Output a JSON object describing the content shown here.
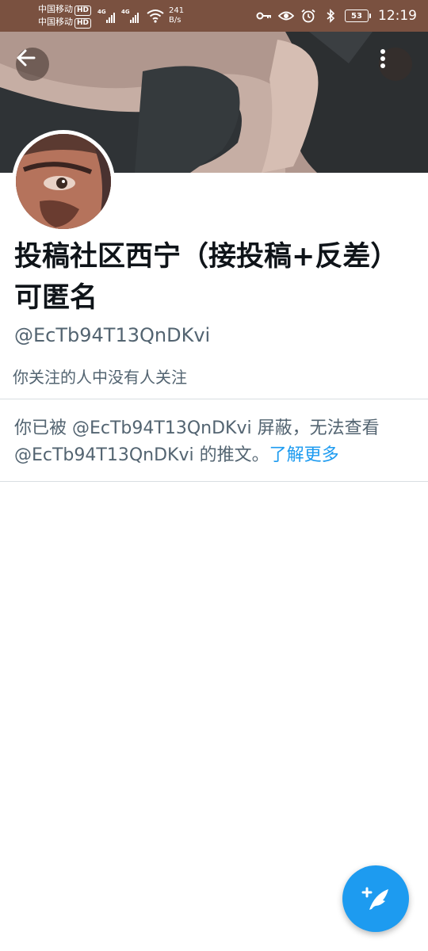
{
  "status_bar": {
    "carrier_1": "中国移动",
    "carrier_2": "中国移动",
    "hd_badge": "HD",
    "network_1": "4G",
    "network_2": "4G",
    "speed_value": "241",
    "speed_unit": "B/s",
    "battery_level": "53",
    "time": "12:19",
    "icons": [
      "key-icon",
      "eye-icon",
      "alarm-icon",
      "bluetooth-icon",
      "battery-icon"
    ]
  },
  "header": {
    "back_icon": "arrow-left-icon",
    "more_icon": "more-vertical-icon"
  },
  "profile": {
    "display_name": "投稿社区西宁（接投稿+反差）可匿名",
    "handle": "@EcTb94T13QnDKvi",
    "followers_you_know": "你关注的人中没有人关注"
  },
  "blocked_notice": {
    "text": "你已被 @EcTb94T13QnDKvi 屏蔽，无法查看 @EcTb94T13QnDKvi 的推文。",
    "link_text": "了解更多"
  },
  "fab": {
    "icon": "compose-tweet-icon"
  },
  "colors": {
    "accent": "#1d9bf0",
    "status_bar_bg": "#7a5140",
    "secondary_text": "#536471",
    "primary_text": "#0f1419"
  }
}
